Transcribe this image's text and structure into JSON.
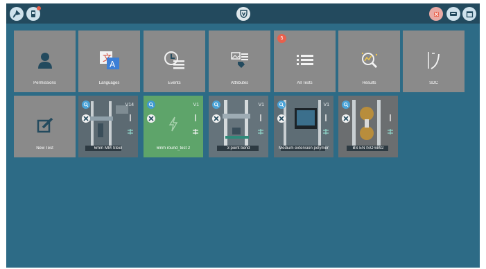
{
  "topbar": {
    "left_icons": [
      "satellite-dish-icon",
      "device-notification-icon"
    ],
    "center_icon": "shield-logo-icon",
    "right_icons": [
      "error-log-icon",
      "keyboard-icon",
      "calendar-icon"
    ],
    "accent": "#e8604c"
  },
  "tiles": [
    {
      "label": "Permissions",
      "icon": "user-icon"
    },
    {
      "label": "Languages",
      "icon": "translate-icon"
    },
    {
      "label": "Events",
      "icon": "clock-list-icon"
    },
    {
      "label": "Attributes",
      "icon": "image-tag-icon"
    },
    {
      "label": "All Tests",
      "icon": "list-icon",
      "badge": "5"
    },
    {
      "label": "Results",
      "icon": "analytics-icon"
    },
    {
      "label": "SDC",
      "icon": "curve-icon"
    },
    {
      "label": "New Test",
      "icon": "edit-icon"
    }
  ],
  "tests": [
    {
      "label": "6mm MM Steel",
      "version": "V14"
    },
    {
      "label": "6mm round_test 2",
      "version": "V1"
    },
    {
      "label": "3 point bend",
      "version": "V1"
    },
    {
      "label": "Medium extension polymer",
      "version": "V1"
    },
    {
      "label": "BS EN ISO 6892",
      "version": ""
    }
  ],
  "colors": {
    "background": "#2d6b86",
    "topbar": "#234a5e",
    "tile": "#8a8a8a",
    "selected_tile": "#5ea46a"
  }
}
